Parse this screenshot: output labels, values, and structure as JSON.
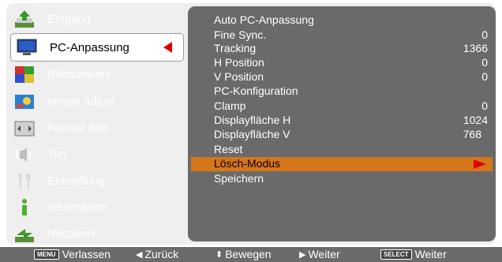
{
  "left_menu": {
    "items": [
      {
        "label": "Eingang",
        "icon": "input-icon"
      },
      {
        "label": "PC-Anpassung",
        "icon": "pc-adjust-icon"
      },
      {
        "label": "Bildauswahl",
        "icon": "image-select-icon"
      },
      {
        "label": "Image adjust",
        "icon": "image-adjust-icon"
      },
      {
        "label": "Format Bild",
        "icon": "screen-format-icon"
      },
      {
        "label": "Ton",
        "icon": "sound-icon"
      },
      {
        "label": "Einstellung",
        "icon": "setting-icon"
      },
      {
        "label": "Information",
        "icon": "information-icon"
      },
      {
        "label": "Netzwerk",
        "icon": "network-icon"
      }
    ],
    "selected_index": 1
  },
  "right_menu": {
    "items": [
      {
        "label": "Auto PC-Anpassung",
        "value": ""
      },
      {
        "label": "Fine Sync.",
        "value": "0"
      },
      {
        "label": "Tracking",
        "value": "1366"
      },
      {
        "label": "H Position",
        "value": "0"
      },
      {
        "label": "V Position",
        "value": "0"
      },
      {
        "label": "PC-Konfiguration",
        "value": ""
      },
      {
        "label": "Clamp",
        "value": "0"
      },
      {
        "label": "Displayfläche H",
        "value": "1024"
      },
      {
        "label": "Displayfläche V",
        "value": "768"
      },
      {
        "label": "Reset",
        "value": ""
      },
      {
        "label": "Lösch-Modus",
        "value": ""
      },
      {
        "label": "Speichern",
        "value": ""
      }
    ],
    "highlighted_index": 10
  },
  "footer": {
    "exit_key": "MENU",
    "exit_label": "Verlassen",
    "back_label": "Zurück",
    "move_label": "Bewegen",
    "next_label": "Weiter",
    "select_key": "SELECT",
    "select_label": "Weiter"
  },
  "colors": {
    "panel": "#6a6a6a",
    "highlight": "#d6761a",
    "arrow": "#e00000"
  }
}
